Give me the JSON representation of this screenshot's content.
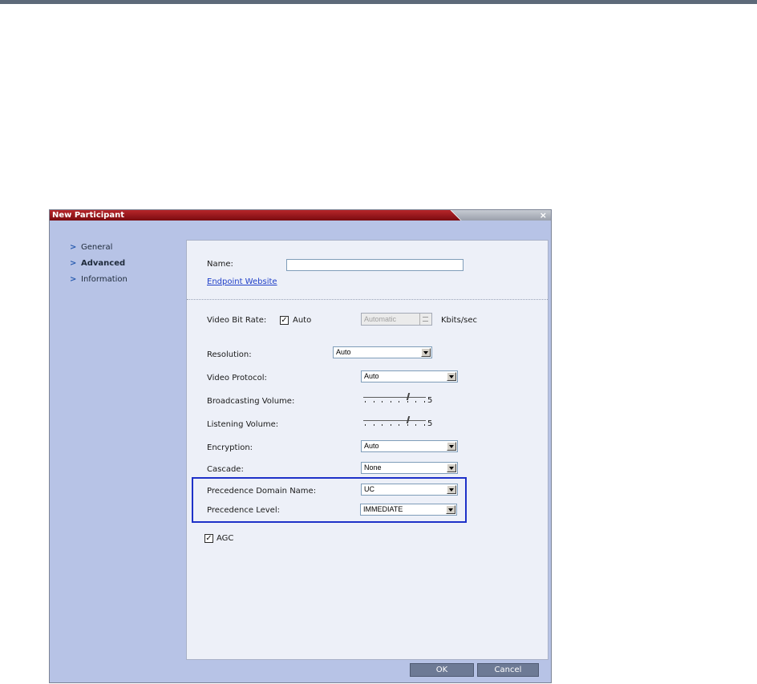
{
  "dialog": {
    "title": "New Participant",
    "close": "×"
  },
  "nav": [
    {
      "label": "General",
      "active": false
    },
    {
      "label": "Advanced",
      "active": true
    },
    {
      "label": "Information",
      "active": false
    }
  ],
  "form": {
    "name_label": "Name:",
    "name_value": "",
    "endpoint_link": "Endpoint Website",
    "video_bit_rate_label": "Video Bit Rate:",
    "auto_checkbox_label": "Auto",
    "auto_checked": "✓",
    "bit_rate_value": "Automatic",
    "bit_rate_unit": "Kbits/sec",
    "resolution_label": "Resolution:",
    "resolution_value": "Auto",
    "video_protocol_label": "Video Protocol:",
    "video_protocol_value": "Auto",
    "broadcasting_volume_label": "Broadcasting Volume:",
    "broadcasting_volume_value": "5",
    "listening_volume_label": "Listening Volume:",
    "listening_volume_value": "5",
    "encryption_label": "Encryption:",
    "encryption_value": "Auto",
    "cascade_label": "Cascade:",
    "cascade_value": "None",
    "precedence_domain_label": "Precedence Domain Name:",
    "precedence_domain_value": "UC",
    "precedence_level_label": "Precedence Level:",
    "precedence_level_value": "IMMEDIATE",
    "agc_label": "AGC",
    "agc_checked": "✓"
  },
  "buttons": {
    "ok": "OK",
    "cancel": "Cancel"
  },
  "colors": {
    "title_red": "#9c1a1f",
    "highlight_blue": "#1e31c8",
    "panel_bg": "#edf0f8",
    "dialog_bg": "#b7c3e6"
  }
}
